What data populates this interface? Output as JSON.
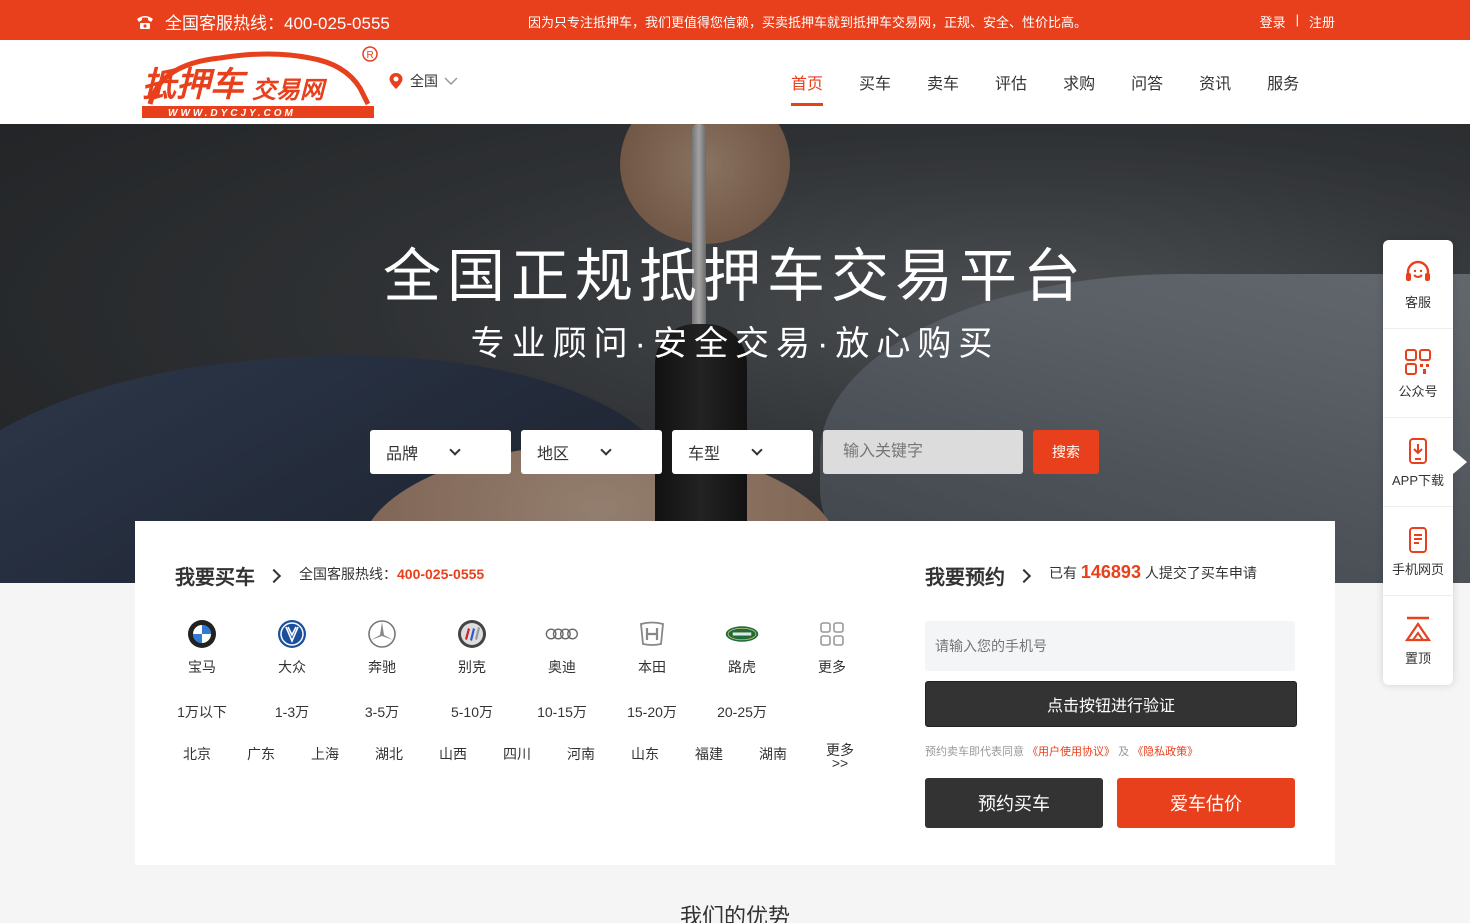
{
  "topbar": {
    "hotline": "全国客服热线：400-025-0555",
    "slogan": "因为只专注抵押车，我们更值得您信赖，买卖抵押车就到抵押车交易网，正规、安全、性价比高。",
    "login": "登录",
    "divider": "|",
    "register": "注册"
  },
  "header": {
    "logo_text": "抵押车交易网",
    "logo_url": "WWW.DYCJY.COM",
    "city": "全国",
    "nav": [
      "首页",
      "买车",
      "卖车",
      "评估",
      "求购",
      "问答",
      "资讯",
      "服务"
    ]
  },
  "hero": {
    "title": "全国正规抵押车交易平台",
    "subtitle": "专业顾问·安全交易·放心购买",
    "search": {
      "brand": "品牌",
      "region": "地区",
      "type": "车型",
      "placeholder": "输入关键字",
      "button": "搜索"
    }
  },
  "buy": {
    "title": "我要买车",
    "hotline_label": "全国客服热线：",
    "hotline_number": "400-025-0555",
    "brands": [
      "宝马",
      "大众",
      "奔驰",
      "别克",
      "奥迪",
      "本田",
      "路虎",
      "更多"
    ],
    "prices": [
      "1万以下",
      "1-3万",
      "3-5万",
      "5-10万",
      "10-15万",
      "15-20万",
      "20-25万"
    ],
    "regions": [
      "北京",
      "广东",
      "上海",
      "湖北",
      "山西",
      "四川",
      "河南",
      "山东",
      "福建",
      "湖南"
    ],
    "regions_more_1": "更多",
    "regions_more_2": ">>"
  },
  "booking": {
    "title": "我要预约",
    "count_prefix": "已有",
    "count": "146893",
    "count_suffix": "人提交了买车申请",
    "phone_placeholder": "请输入您的手机号",
    "verify": "点击按钮进行验证",
    "agree_text": "预约卖车即代表同意",
    "agree_link1": "《用户使用协议》",
    "agree_and": "及",
    "agree_link2": "《隐私政策》",
    "btn_book": "预约买车",
    "btn_estimate": "爱车估价"
  },
  "advantage_title": "我们的优势",
  "dock": [
    "客服",
    "公众号",
    "APP下载",
    "手机网页",
    "置顶"
  ],
  "colors": {
    "accent": "#e8401c",
    "dark": "#333333"
  }
}
